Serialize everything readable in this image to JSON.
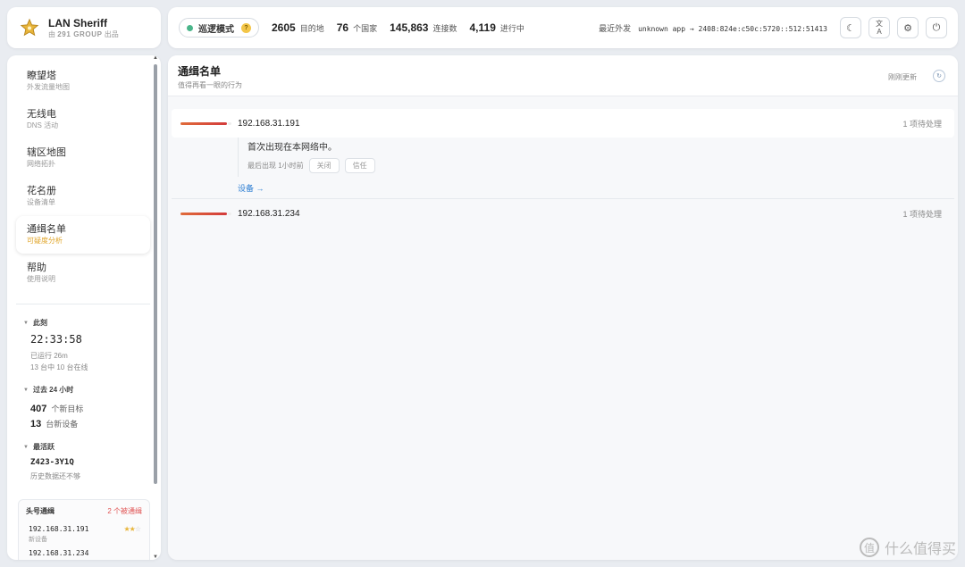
{
  "app": {
    "name": "LAN Sheriff",
    "by_prefix": "由",
    "by_group": "291 GROUP",
    "by_suffix": "出品"
  },
  "topbar": {
    "mode_label": "巡逻模式",
    "mode_help": "?",
    "stats": [
      {
        "value": "2605",
        "label": "目的地"
      },
      {
        "value": "76",
        "label": "个国家"
      },
      {
        "value": "145,863",
        "label": "连接数"
      },
      {
        "value": "4,119",
        "label": "进行中"
      }
    ],
    "recent_label": "最近外发",
    "recent_value": "unknown app → 2408:824e:c50c:5720::512:51413",
    "icons": {
      "theme": "☾",
      "lang_top": "文",
      "lang_bottom": "A",
      "settings": "⚙",
      "power": "⏻"
    }
  },
  "sidebar": {
    "items": [
      {
        "title": "瞭望塔",
        "sub": "外发流量地图"
      },
      {
        "title": "无线电",
        "sub": "DNS 活动"
      },
      {
        "title": "辖区地图",
        "sub": "网络拓扑"
      },
      {
        "title": "花名册",
        "sub": "设备清单"
      },
      {
        "title": "通缉名单",
        "sub": "可疑度分析"
      },
      {
        "title": "帮助",
        "sub": "使用说明"
      }
    ],
    "now": {
      "label": "此刻",
      "time": "22:33:58",
      "uptime": "已运行 26m",
      "online": "13 台中 10 台在线"
    },
    "past24": {
      "label": "过去 24 小时",
      "targets_value": "407",
      "targets_label": "个新目标",
      "devices_value": "13",
      "devices_label": "台新设备"
    },
    "most_active": {
      "label": "最活跃",
      "name": "Z423-3Y1Q",
      "note": "历史数据还不够"
    },
    "top_wanted": {
      "label": "头号通缉",
      "count": "2 个被通缉",
      "rows": [
        {
          "ip": "192.168.31.191",
          "tag": "新设备",
          "stars": 2,
          "max": 3
        },
        {
          "ip": "192.168.31.234"
        }
      ]
    }
  },
  "main": {
    "title": "通缉名单",
    "subtitle": "值得再看一眼的行为",
    "updated": "刚刚更新",
    "refresh_icon": "↻",
    "entries": [
      {
        "ip": "192.168.31.191",
        "pending": "1 项待处理",
        "message": "首次出现在本网络中。",
        "last_seen": "最后出现 1小时前",
        "close_label": "关闭",
        "trust_label": "信任",
        "link": "设备 →"
      },
      {
        "ip": "192.168.31.234",
        "pending": "1 项待处理"
      }
    ]
  },
  "watermark": {
    "glyph": "值",
    "text": "什么值得买"
  },
  "colors": {
    "accent": "#e0a52a",
    "danger_bar_start": "#e06b3a",
    "danger_bar_end": "#d33b3b",
    "link": "#2f7fd3",
    "online_dot": "#4ab58a"
  }
}
